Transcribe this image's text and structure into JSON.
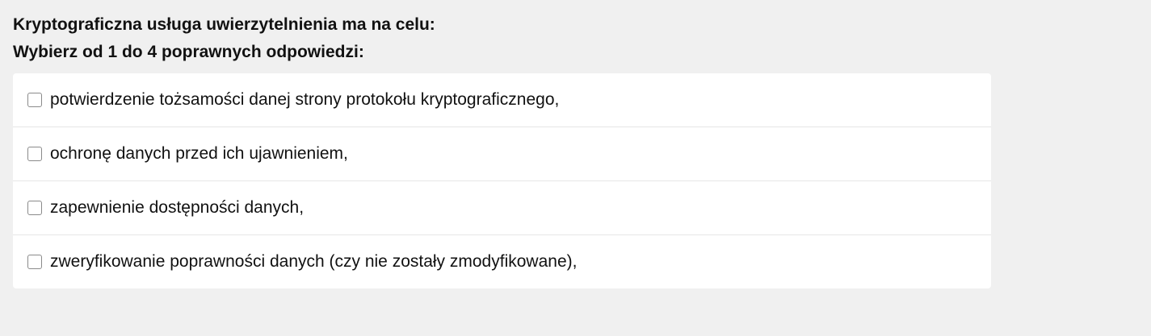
{
  "question": {
    "title": "Kryptograficzna usługa uwierzytelnienia ma na celu:",
    "instruction": "Wybierz od 1 do 4 poprawnych odpowiedzi:"
  },
  "answers": [
    {
      "label": "potwierdzenie tożsamości danej strony protokołu kryptograficznego,",
      "checked": false
    },
    {
      "label": "ochronę danych przed ich ujawnieniem,",
      "checked": false
    },
    {
      "label": "zapewnienie dostępności danych,",
      "checked": false
    },
    {
      "label": "zweryfikowanie poprawności danych (czy nie zostały zmodyfikowane),",
      "checked": false
    }
  ]
}
